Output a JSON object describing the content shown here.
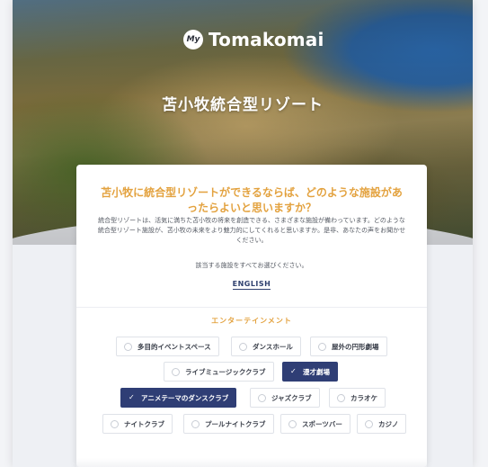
{
  "brand": {
    "logo_badge": "My",
    "name": "Tomakomai"
  },
  "hero": {
    "title": "苫小牧統合型リゾート"
  },
  "survey": {
    "question": "苫小牧に統合型リゾートができるならば、どのような施設があったらよいと思いますか？",
    "description": "統合型リゾートは、活気に満ちた苫小牧の将来を創造できる、さまざまな施設が備わっています。どのような統合型リゾート施設が、苫小牧の未来をより魅力的にしてくれると思いますか。是非、あなたの声をお聞かせください。",
    "instruction": "該当する施設をすべてお選びください。",
    "language_link": "ENGLISH"
  },
  "section": {
    "title": "エンターテインメント",
    "options": [
      {
        "label": "多目的イベントスペース",
        "selected": false
      },
      {
        "label": "ダンスホール",
        "selected": false
      },
      {
        "label": "屋外の円形劇場",
        "selected": false
      },
      {
        "label": "ライブミュージッククラブ",
        "selected": false
      },
      {
        "label": "漫才劇場",
        "selected": true
      },
      {
        "label": "アニメテーマのダンスクラブ",
        "selected": true
      },
      {
        "label": "ジャズクラブ",
        "selected": false
      },
      {
        "label": "カラオケ",
        "selected": false
      },
      {
        "label": "ナイトクラブ",
        "selected": false
      },
      {
        "label": "プールナイトクラブ",
        "selected": false
      },
      {
        "label": "スポーツバー",
        "selected": false
      },
      {
        "label": "カジノ",
        "selected": false
      }
    ]
  },
  "colors": {
    "accent": "#e3a23f",
    "selected": "#2f3e75"
  }
}
